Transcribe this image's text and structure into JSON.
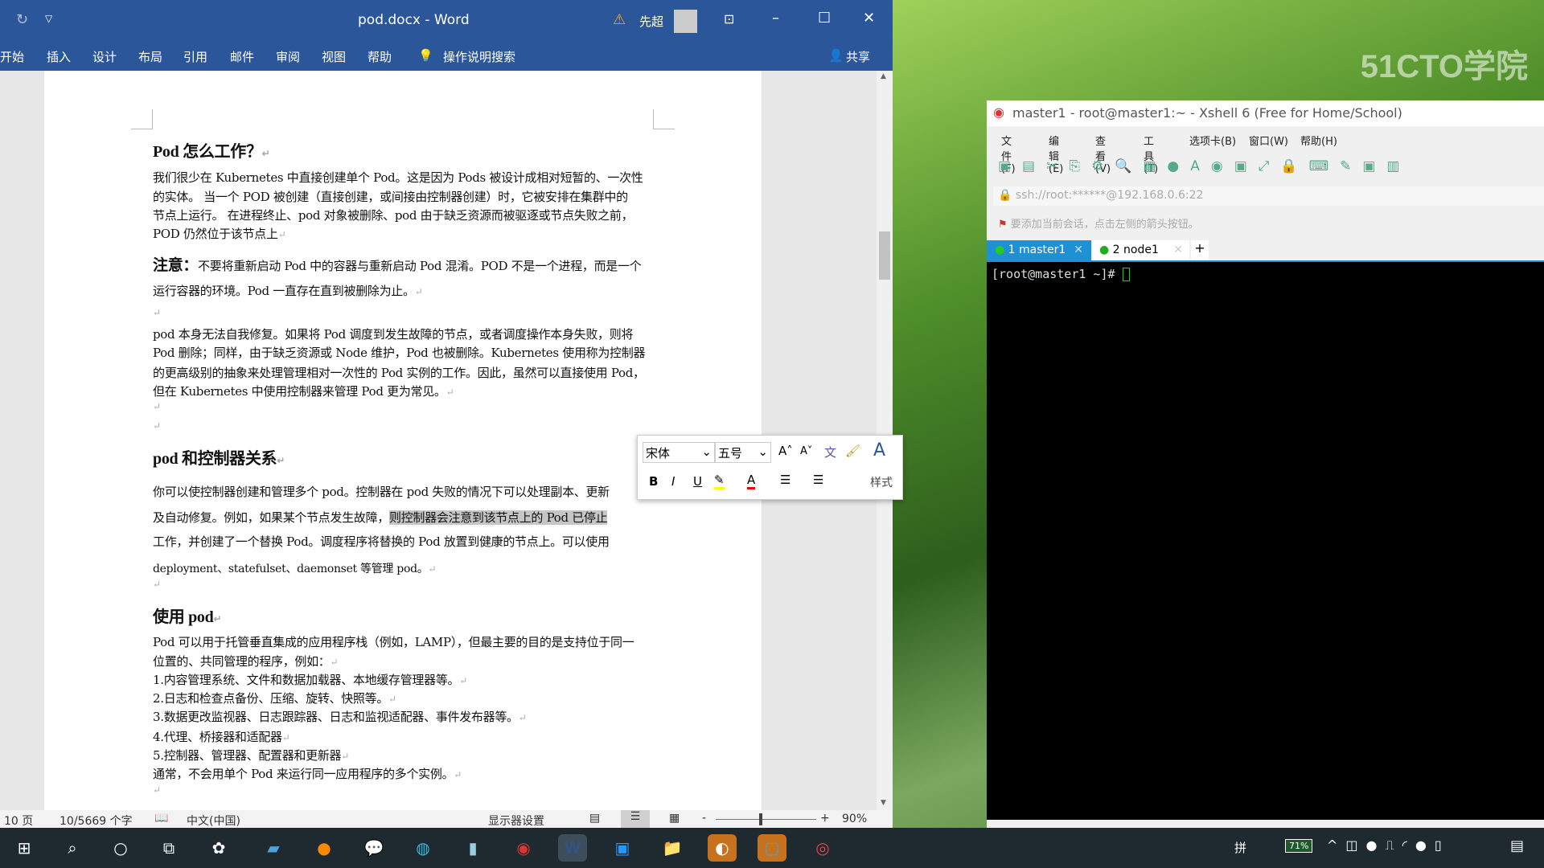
{
  "word": {
    "title": "pod.docx - Word",
    "user": "先超",
    "tabs": [
      "开始",
      "插入",
      "设计",
      "布局",
      "引用",
      "邮件",
      "审阅",
      "视图",
      "帮助"
    ],
    "search": "操作说明搜索",
    "share": "共享",
    "doc": {
      "h1": "Pod 怎么工作？",
      "p1": [
        "我们很少在 Kubernetes 中直接创建单个 Pod。这是因为 Pods 被设计成相对短暂的、一次性",
        "的实体。 当一个 POD 被创建（直接创建，或间接由控制器创建）时，它被安排在集群中的",
        "节点上运行。 在进程终止、pod 对象被删除、pod 由于缺乏资源而被驱逐或节点失败之前，",
        "POD 仍然位于该节点上"
      ],
      "note_label": "注意：",
      "note": [
        "不要将重新启动 Pod 中的容器与重新启动 Pod 混淆。POD 不是一个进程，而是一个",
        "运行容器的环境。Pod 一直存在直到被删除为止。"
      ],
      "p3": [
        "pod 本身无法自我修复。如果将 Pod 调度到发生故障的节点，或者调度操作本身失败，则将",
        "Pod 删除；同样，由于缺乏资源或 Node 维护，Pod 也被删除。Kubernetes 使用称为控制器",
        "的更高级别的抽象来处理管理相对一次性的 Pod 实例的工作。因此，虽然可以直接使用 Pod，",
        "但在 Kubernetes 中使用控制器来管理 Pod 更为常见。"
      ],
      "h2": "pod 和控制器关系",
      "p4_1": "你可以使控制器创建和管理多个 pod。控制器在 pod 失败的情况下可以处理副本、更新",
      "p4_2a": "及自动修复。例如，如果某个节点发生故障，",
      "p4_2sel": "则控制器会注意到该节点上的 Pod 已停止",
      "p4_3": "工作，并创建了一个替换 Pod。调度程序将替换的 Pod 放置到健康的节点上。可以使用",
      "p4_4": "deployment、statefulset、daemonset 等管理 pod。",
      "h3": "使用 pod",
      "p5": [
        "Pod 可以用于托管垂直集成的应用程序栈（例如，LAMP），但最主要的目的是支持位于同一",
        "位置的、共同管理的程序，例如："
      ],
      "list": [
        "1.内容管理系统、文件和数据加载器、本地缓存管理器等。",
        "2.日志和检查点备份、压缩、旋转、快照等。",
        "3.数据更改监视器、日志跟踪器、日志和监视适配器、事件发布器等。",
        "4.代理、桥接器和适配器",
        "5.控制器、管理器、配置器和更新器"
      ],
      "last": "通常，不会用单个 Pod 来运行同一应用程序的多个实例。",
      "pilcrow": "↵"
    },
    "mini": {
      "font": "宋体",
      "size": "五号",
      "styles": "样式",
      "bold": "B",
      "italic": "I",
      "underline": "U",
      "color": "A"
    },
    "status": {
      "page": "10 页",
      "words": "10/5669 个字",
      "lang": "中文(中国)",
      "display": "显示器设置",
      "zoom": "90%",
      "zoom_pct": 90
    }
  },
  "xshell": {
    "title": "master1 - root@master1:~ - Xshell 6 (Free for Home/School)",
    "menu": [
      "文件(F)",
      "编辑(E)",
      "查看(V)",
      "工具(T)",
      "选项卡(B)",
      "窗口(W)",
      "帮助(H)"
    ],
    "address": "ssh://root:******@192.168.0.6:22",
    "hint": "要添加当前会话，点击左侧的箭头按钮。",
    "tabs": [
      "1 master1",
      "2 node1"
    ],
    "add_tab": "+",
    "prompt": "[root@master1 ~]# "
  },
  "desktop": {
    "watermark": "51CTO学院"
  },
  "tray": {
    "battery": "71%",
    "ime": "拼"
  },
  "colors": {
    "word_blue": "#2b579a",
    "xshell_tab": "#1e90d6",
    "terminal_bg": "#000000"
  }
}
